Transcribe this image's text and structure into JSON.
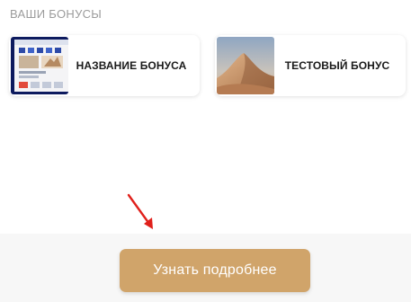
{
  "bonuses": {
    "section_title": "ВАШИ БОНУСЫ",
    "items": [
      {
        "label": "НАЗВАНИЕ БОНУСА",
        "thumbnail": "website-screenshot-thumbnail"
      },
      {
        "label": "ТЕСТОВЫЙ БОНУС",
        "thumbnail": "desert-dunes-thumbnail"
      }
    ]
  },
  "footer": {
    "cta_label": "Узнать подробнее",
    "cta_color": "#d0a46a"
  },
  "annotation": {
    "arrow_color": "#e0201b",
    "icon": "red-arrow-icon"
  }
}
